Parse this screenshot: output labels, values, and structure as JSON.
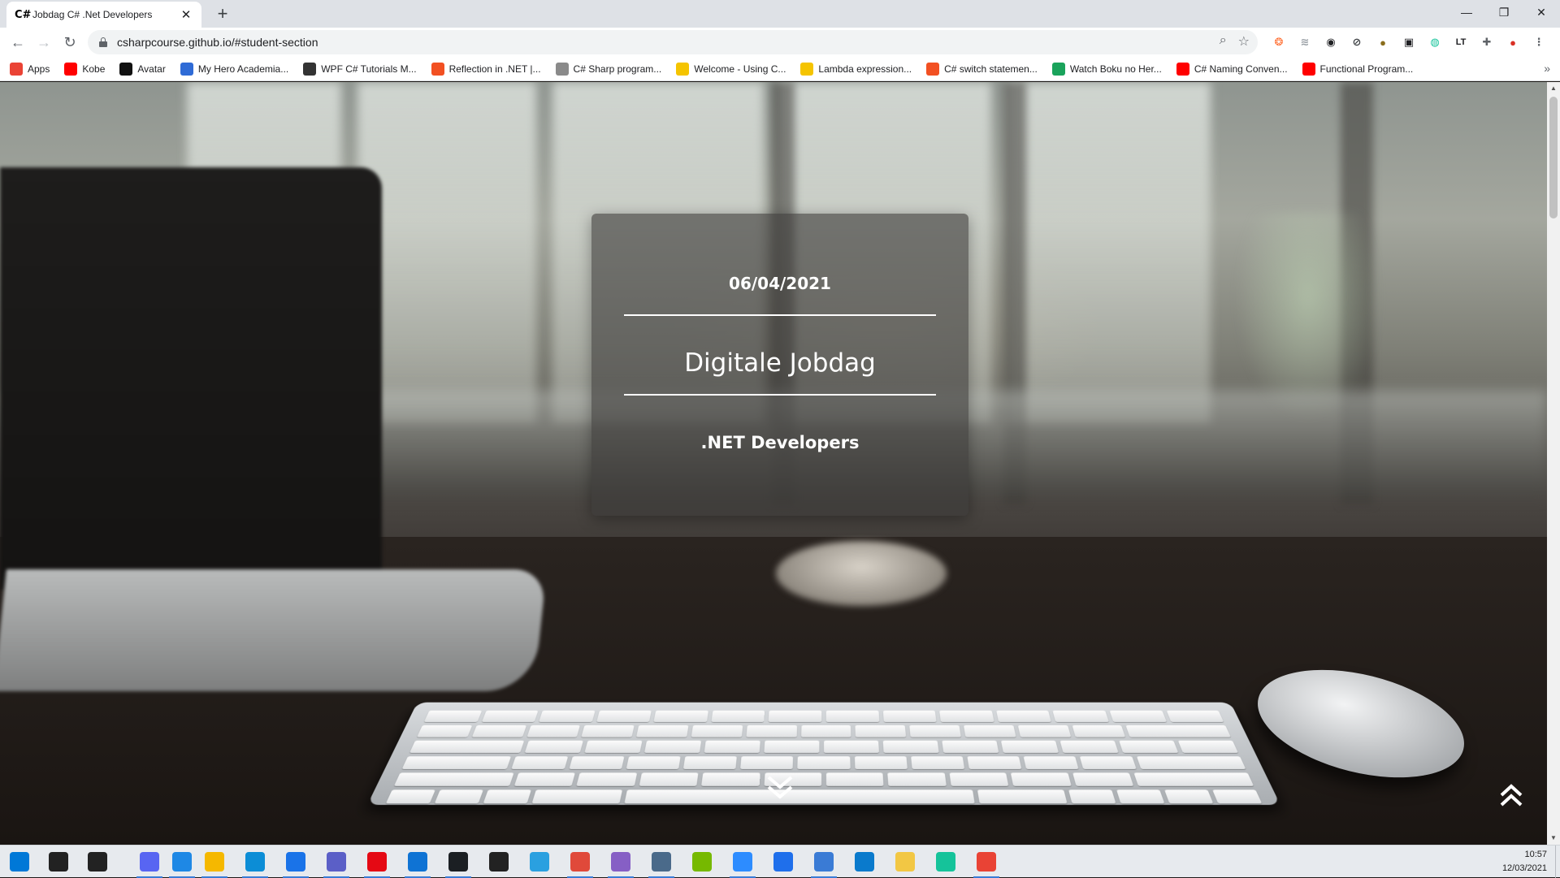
{
  "browser": {
    "tab": {
      "favicon": "C#",
      "title": "Jobdag C# .Net Developers",
      "close": "✕"
    },
    "new_tab": "+",
    "window_controls": [
      "—",
      "❐",
      "✕"
    ],
    "nav": {
      "back": "←",
      "forward": "→",
      "reload": "↻"
    },
    "url": "csharpcourse.github.io/#student-section",
    "omnibox_icons": [
      "zoom-icon",
      "star-icon"
    ],
    "extensions": [
      "ext-1",
      "ext-2",
      "ext-3",
      "ext-4",
      "ext-5",
      "ext-6",
      "ext-7",
      "ext-8",
      "puzzle-icon",
      "profile-avatar",
      "menu-icon"
    ],
    "bookmarks": [
      {
        "label": "Apps",
        "icon": "apps-grid-icon",
        "color": "#ea4335"
      },
      {
        "label": "Kobe",
        "icon": "youtube-icon",
        "color": "#ff0000"
      },
      {
        "label": "Avatar",
        "icon": "avatar-icon",
        "color": "#111111"
      },
      {
        "label": "My Hero Academia...",
        "icon": "crunchyroll-icon",
        "color": "#2f6bd6"
      },
      {
        "label": "WPF C# Tutorials M...",
        "icon": "m-icon",
        "color": "#333333"
      },
      {
        "label": "Reflection in .NET |...",
        "icon": "microsoft-icon",
        "color": "#f25022"
      },
      {
        "label": "C# Sharp program...",
        "icon": "w3r-icon",
        "color": "#8a8a8a"
      },
      {
        "label": "Welcome - Using C...",
        "icon": "pen-icon",
        "color": "#f5c400"
      },
      {
        "label": "Lambda expression...",
        "icon": "pen-icon",
        "color": "#f5c400"
      },
      {
        "label": "C# switch statemen...",
        "icon": "microsoft-icon",
        "color": "#f25022"
      },
      {
        "label": "Watch Boku no Her...",
        "icon": "shield-icon",
        "color": "#1aa35b"
      },
      {
        "label": "C# Naming Conven...",
        "icon": "youtube-icon",
        "color": "#ff0000"
      },
      {
        "label": "Functional Program...",
        "icon": "youtube-icon",
        "color": "#ff0000"
      }
    ],
    "bookmarks_more": "»"
  },
  "page": {
    "hero": {
      "date": "06/04/2021",
      "title": "Digitale Jobdag",
      "subtitle": ".NET Developers"
    }
  },
  "taskbar": {
    "items": [
      {
        "name": "windows-start-icon",
        "color": "#0078d7"
      },
      {
        "name": "search-icon",
        "color": "#222222"
      },
      {
        "name": "task-view-icon",
        "color": "#222222"
      },
      {
        "name": "discord-icon",
        "color": "#5865f2"
      },
      {
        "name": "app-blue-icon",
        "color": "#1e88e5"
      },
      {
        "name": "file-explorer-icon",
        "color": "#f5b800"
      },
      {
        "name": "edge-icon",
        "color": "#0c8dd6"
      },
      {
        "name": "mail-icon",
        "color": "#1a73e8"
      },
      {
        "name": "teams-icon",
        "color": "#5b5fc7"
      },
      {
        "name": "netflix-icon",
        "color": "#e50914"
      },
      {
        "name": "app-sync-icon",
        "color": "#0f73d4"
      },
      {
        "name": "github-icon",
        "color": "#1b1f23"
      },
      {
        "name": "overwatch-icon",
        "color": "#222222"
      },
      {
        "name": "app-f-icon",
        "color": "#2aa0e0"
      },
      {
        "name": "app-swirl-icon",
        "color": "#e0493a"
      },
      {
        "name": "visual-studio-icon",
        "color": "#865fc5"
      },
      {
        "name": "app-printer-icon",
        "color": "#4a6a8a"
      },
      {
        "name": "nvidia-icon",
        "color": "#76b900"
      },
      {
        "name": "zoom-icon",
        "color": "#2d8cff"
      },
      {
        "name": "app-code-icon",
        "color": "#1f6feb"
      },
      {
        "name": "app-window-icon",
        "color": "#3a7bd5"
      },
      {
        "name": "vscode-icon",
        "color": "#0a7acc"
      },
      {
        "name": "app-notes-icon",
        "color": "#f2c744"
      },
      {
        "name": "grammarly-icon",
        "color": "#15c39a"
      },
      {
        "name": "chrome-icon",
        "color": "#e94335"
      }
    ],
    "time": "10:57",
    "date": "12/03/2021"
  }
}
